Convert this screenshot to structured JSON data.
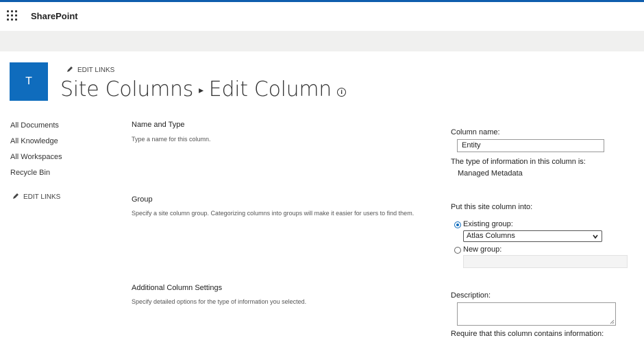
{
  "suite": {
    "app_name": "SharePoint",
    "waffle_icon": "app-launcher-icon"
  },
  "site": {
    "tile_letter": "T",
    "edit_links_label": "EDIT LINKS"
  },
  "page": {
    "breadcrumb_parent": "Site Columns",
    "breadcrumb_separator": "▸",
    "breadcrumb_current": "Edit Column",
    "info_glyph": "i"
  },
  "leftnav": {
    "items": [
      "All Documents",
      "All Knowledge",
      "All Workspaces",
      "Recycle Bin"
    ],
    "edit_links_label": "EDIT LINKS"
  },
  "sections": {
    "name_type": {
      "title": "Name and Type",
      "desc": "Type a name for this column."
    },
    "group": {
      "title": "Group",
      "desc": "Specify a site column group. Categorizing columns into groups will make it easier for users to find them."
    },
    "additional": {
      "title": "Additional Column Settings",
      "desc": "Specify detailed options for the type of information you selected."
    }
  },
  "form": {
    "column_name_label": "Column name:",
    "column_name_value": "Entity",
    "type_label": "The type of information in this column is:",
    "type_value": "Managed Metadata",
    "put_into_label": "Put this site column into:",
    "existing_group_label": "Existing group:",
    "existing_group_selected": "Atlas Columns",
    "new_group_label": "New group:",
    "description_label": "Description:",
    "require_label": "Require that this column contains information:"
  },
  "colors": {
    "accent": "#0f6cbd",
    "top_stripe": "#0f5ead",
    "greybar": "#f0f0ef"
  }
}
